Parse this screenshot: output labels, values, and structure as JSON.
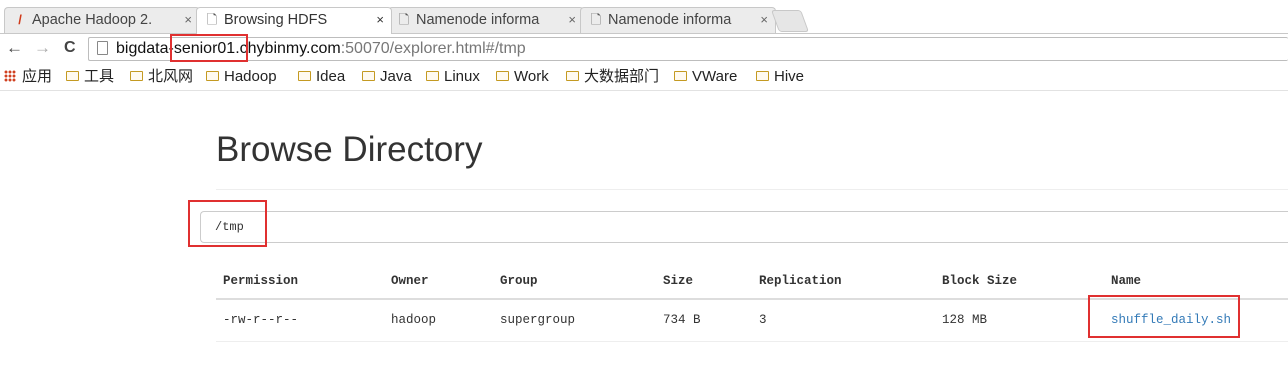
{
  "tabs": [
    {
      "icon": "hadoop-favicon",
      "title": "Apache Hadoop 2.",
      "active": false
    },
    {
      "icon": "page-icon",
      "title": "Browsing HDFS",
      "active": true
    },
    {
      "icon": "page-icon",
      "title": "Namenode informa",
      "active": false
    },
    {
      "icon": "page-icon",
      "title": "Namenode informa",
      "active": false
    }
  ],
  "tab_close_glyph": "×",
  "nav": {
    "back": "←",
    "forward": "→",
    "reload": "C"
  },
  "address": {
    "host_part": "bigdata-senior01.chybinmy.com",
    "rest_part": ":50070/explorer.html#/tmp"
  },
  "bookmarks": [
    {
      "label": "应用",
      "kind": "apps"
    },
    {
      "label": "工具",
      "kind": "folder"
    },
    {
      "label": "北风网",
      "kind": "folder"
    },
    {
      "label": "Hadoop",
      "kind": "folder"
    },
    {
      "label": "Idea",
      "kind": "folder"
    },
    {
      "label": "Java",
      "kind": "folder"
    },
    {
      "label": "Linux",
      "kind": "folder"
    },
    {
      "label": "Work",
      "kind": "folder"
    },
    {
      "label": "大数据部门",
      "kind": "folder"
    },
    {
      "label": "VWare",
      "kind": "folder"
    },
    {
      "label": "Hive",
      "kind": "folder"
    }
  ],
  "page": {
    "title": "Browse Directory",
    "path_value": "/tmp",
    "columns": [
      "Permission",
      "Owner",
      "Group",
      "Size",
      "Replication",
      "Block Size",
      "Name"
    ],
    "rows": [
      [
        "-rw-r--r--",
        "hadoop",
        "supergroup",
        "734 B",
        "3",
        "128 MB",
        "shuffle_daily.sh"
      ]
    ]
  },
  "highlight_color": "#e03030",
  "link_color": "#337ab7"
}
